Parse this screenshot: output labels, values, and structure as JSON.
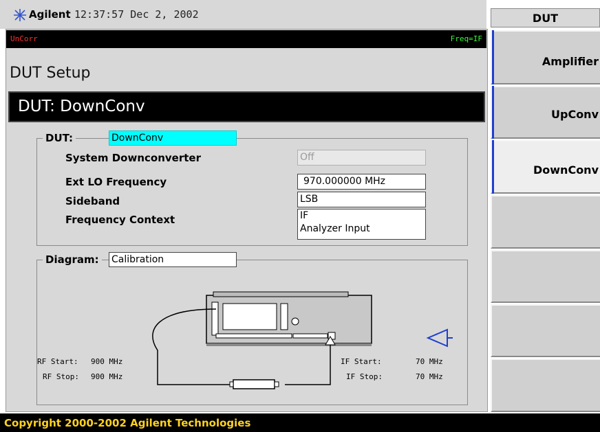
{
  "title_bar": {
    "brand": "Agilent",
    "datetime": "12:37:57  Dec 2, 2002"
  },
  "status": {
    "left": "UnCorr",
    "right": "Freq=IF"
  },
  "screen_title": "DUT Setup",
  "dut_banner": "DUT: DownConv",
  "dut_group": {
    "legend": "DUT:",
    "dut_value": "DownConv",
    "rows": [
      {
        "label": "System Downconverter",
        "value": "Off"
      },
      {
        "label": "Ext LO Frequency",
        "value": "970.000000 MHz"
      },
      {
        "label": "Sideband",
        "value": "LSB"
      },
      {
        "label": "Frequency Context",
        "value": "IF",
        "value2": "Analyzer Input"
      }
    ]
  },
  "diagram": {
    "legend": "Diagram:",
    "value": "Calibration",
    "rf_start_label": "RF Start:",
    "rf_start_value": "900 MHz",
    "rf_stop_label": "RF Stop:",
    "rf_stop_value": "900 MHz",
    "if_start_label": "IF Start:",
    "if_start_value": "70 MHz",
    "if_stop_label": "IF Stop:",
    "if_stop_value": "70 MHz"
  },
  "softkeys": {
    "header": "DUT",
    "items": [
      "Amplifier",
      "UpConv",
      "DownConv",
      "",
      "",
      "",
      ""
    ],
    "selected_index": 2
  },
  "footer": "Copyright 2000-2002 Agilent Technologies",
  "colors": {
    "accent_blue": "#1f3fd0",
    "highlight_cyan": "#00ffff",
    "footer_text": "#ffd21f"
  }
}
